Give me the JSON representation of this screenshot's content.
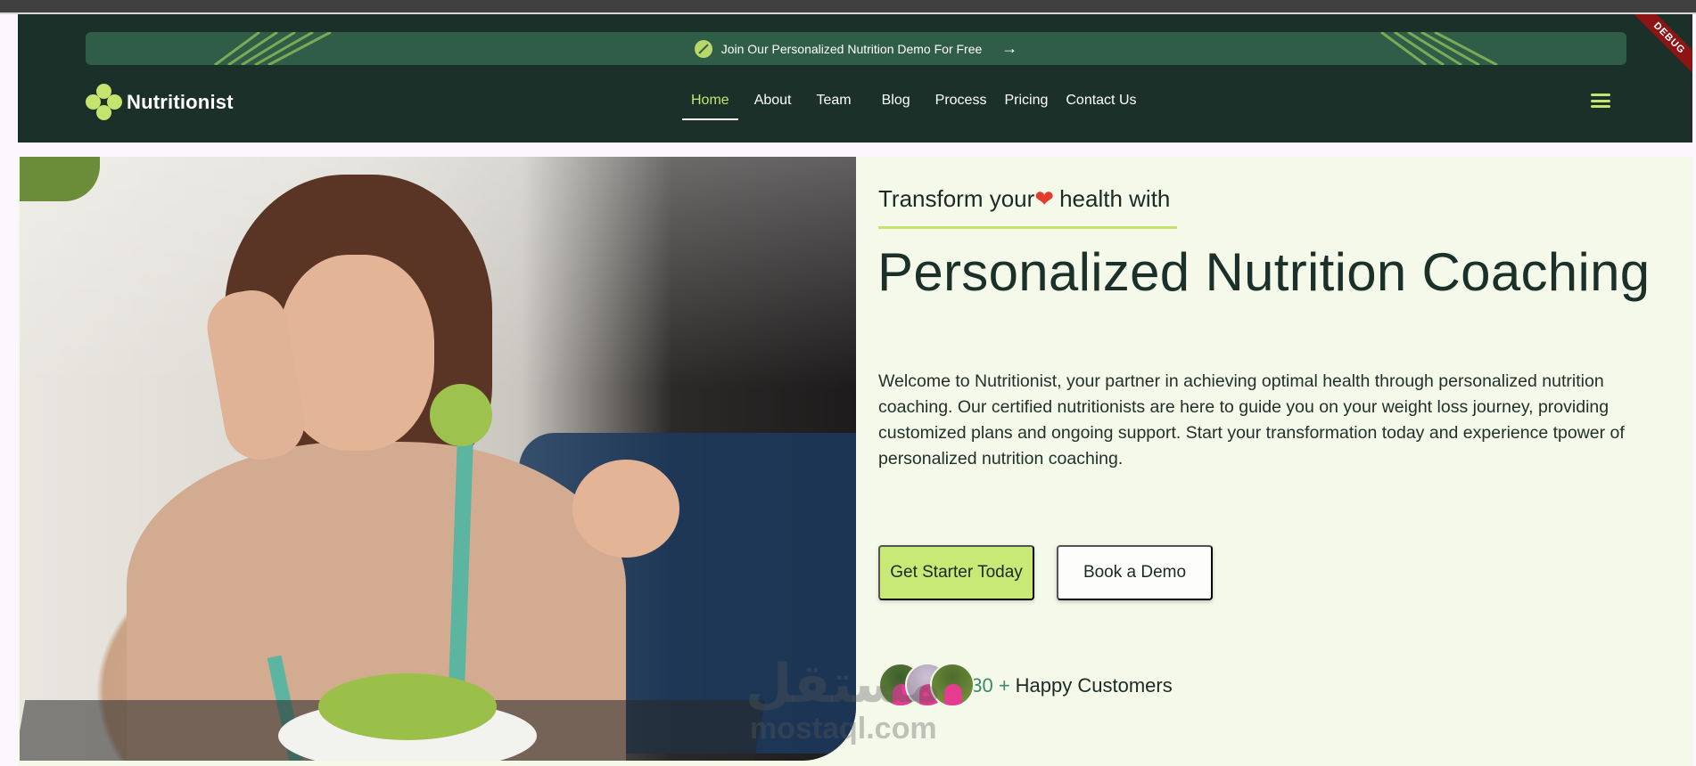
{
  "announcement": {
    "text": "Join Our Personalized Nutrition Demo For Free",
    "arrow": "→"
  },
  "brand": {
    "name": "Nutritionist"
  },
  "nav": {
    "items": [
      {
        "label": "Home",
        "active": true
      },
      {
        "label": "About"
      },
      {
        "label": "Team"
      },
      {
        "label": "Blog"
      },
      {
        "label": "Process"
      },
      {
        "label": "Pricing"
      },
      {
        "label": "Contact Us"
      }
    ]
  },
  "debug_banner": "DEBUG",
  "hero": {
    "tagline_before": "Transform your",
    "tagline_after": " health with",
    "heart": "❤",
    "headline": "Personalized Nutrition Coaching",
    "description": "Welcome to Nutritionist, your partner in achieving optimal health through personalized nutrition coaching. Our certified nutritionists are here to guide you on your weight loss journey, providing customized plans and ongoing support. Start your transformation today and experience tpower of personalized nutrition coaching.",
    "primary_button": "Get Starter Today",
    "secondary_button": "Book a Demo",
    "customers_count": "430 +",
    "customers_label": "Happy Customers"
  },
  "watermark": {
    "arabic": "مستقل",
    "latin": "mostaql.com"
  },
  "colors": {
    "header_bg": "#1a3028",
    "accent": "#c4e46f",
    "hero_bg": "#f4f9ea"
  }
}
